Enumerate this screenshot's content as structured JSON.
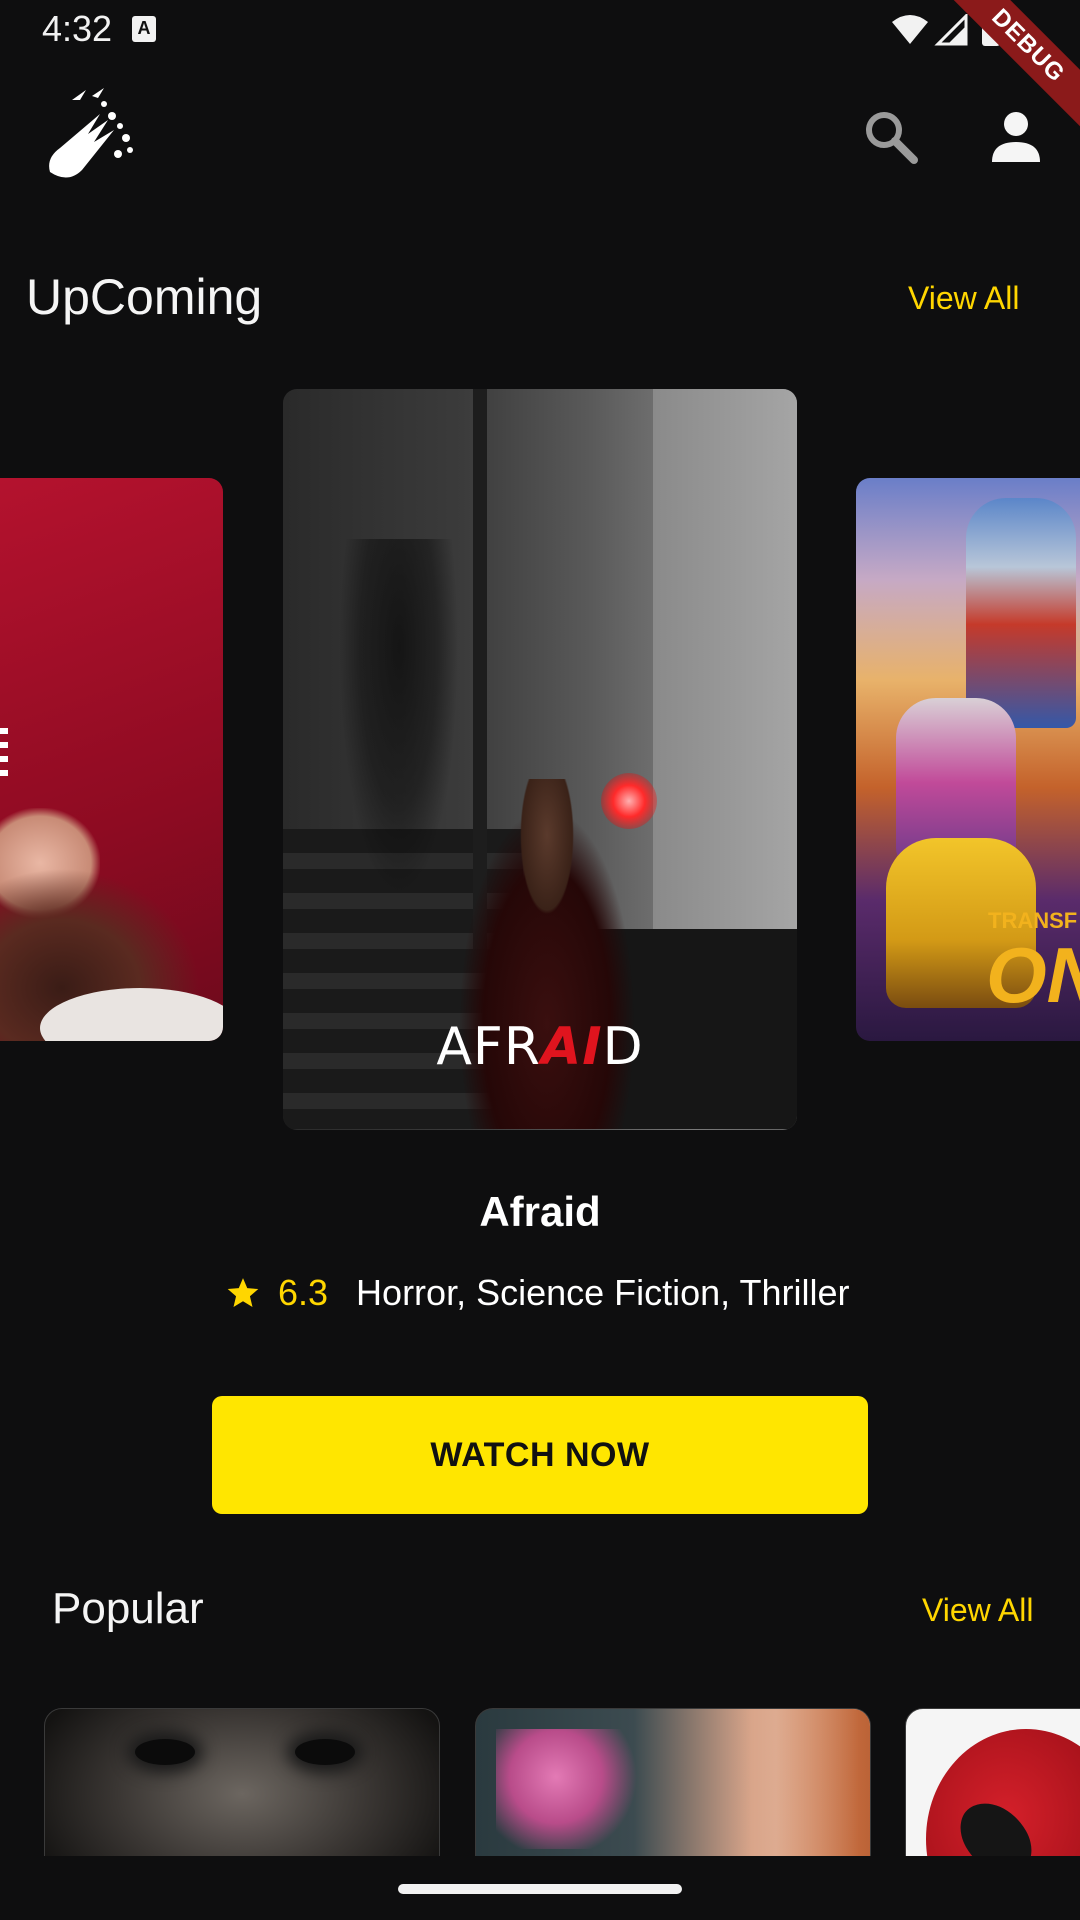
{
  "status_bar": {
    "time": "4:32",
    "notification_icon": "A",
    "debug_label": "DEBUG"
  },
  "app_bar": {
    "logo": "meteor-logo-icon",
    "search_icon": "search-icon",
    "profile_icon": "person-icon"
  },
  "upcoming": {
    "title": "UpComing",
    "view_all": "View All",
    "posters": [
      {
        "title": "",
        "position": "previous"
      },
      {
        "title_part1": "AFR",
        "title_part2": "AI",
        "title_part3": "D",
        "position": "current"
      },
      {
        "brand_small": "TRANSF",
        "brand_big": "ON",
        "position": "next"
      }
    ]
  },
  "featured": {
    "title": "Afraid",
    "rating": "6.3",
    "genres": "Horror, Science Fiction, Thriller",
    "cta_label": "WATCH NOW"
  },
  "popular": {
    "title": "Popular",
    "view_all": "View All"
  },
  "colors": {
    "accent": "#ffd600",
    "button": "#ffe600",
    "background": "#0e0e0f"
  }
}
